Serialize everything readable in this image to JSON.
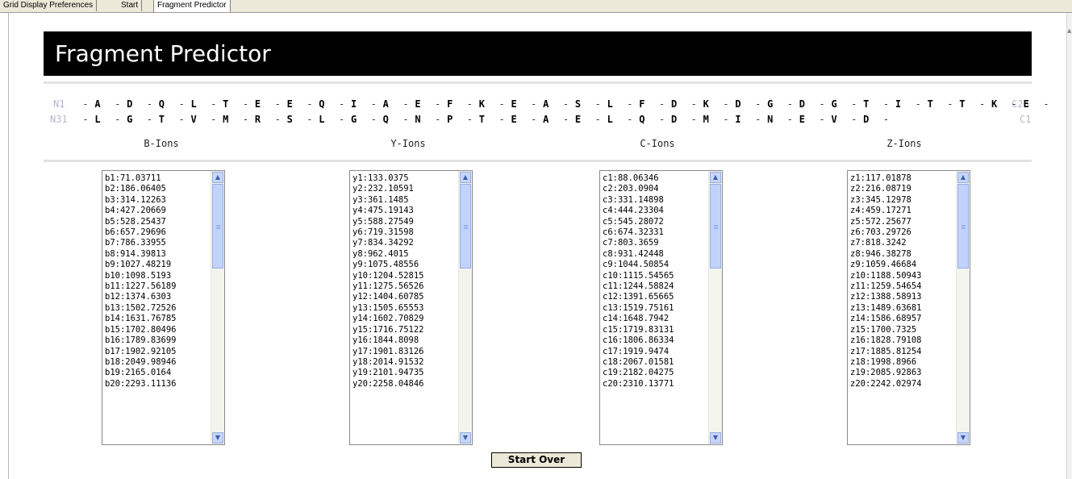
{
  "tabs": [
    {
      "label": "Grid Display Preferences"
    },
    {
      "label": "Start"
    },
    {
      "label": "Fragment Predictor",
      "active": true
    }
  ],
  "banner": {
    "title": "Fragment Predictor"
  },
  "sequence": {
    "row1": {
      "n_term": "N1",
      "c_term": "C26",
      "residues": [
        "A",
        "D",
        "Q",
        "L",
        "T",
        "E",
        "E",
        "Q",
        "I",
        "A",
        "E",
        "F",
        "K",
        "E",
        "A",
        "S",
        "L",
        "F",
        "D",
        "K",
        "D",
        "G",
        "D",
        "G",
        "T",
        "I",
        "T",
        "T",
        "K",
        "E"
      ]
    },
    "row2": {
      "n_term": "N31",
      "c_term": "C1",
      "residues": [
        "L",
        "G",
        "T",
        "V",
        "M",
        "R",
        "S",
        "L",
        "G",
        "Q",
        "N",
        "P",
        "T",
        "E",
        "A",
        "E",
        "L",
        "Q",
        "D",
        "M",
        "I",
        "N",
        "E",
        "V",
        "D"
      ]
    }
  },
  "ion_columns": [
    {
      "header": "B-Ions",
      "items": [
        "b1:71.03711",
        "b2:186.06405",
        "b3:314.12263",
        "b4:427.20669",
        "b5:528.25437",
        "b6:657.29696",
        "b7:786.33955",
        "b8:914.39813",
        "b9:1027.48219",
        "b10:1098.5193",
        "b11:1227.56189",
        "b12:1374.6303",
        "b13:1502.72526",
        "b14:1631.76785",
        "b15:1702.80496",
        "b16:1789.83699",
        "b17:1902.92105",
        "b18:2049.98946",
        "b19:2165.0164",
        "b20:2293.11136"
      ]
    },
    {
      "header": "Y-Ions",
      "items": [
        "y1:133.0375",
        "y2:232.10591",
        "y3:361.1485",
        "y4:475.19143",
        "y5:588.27549",
        "y6:719.31598",
        "y7:834.34292",
        "y8:962.4015",
        "y9:1075.48556",
        "y10:1204.52815",
        "y11:1275.56526",
        "y12:1404.60785",
        "y13:1505.65553",
        "y14:1602.70829",
        "y15:1716.75122",
        "y16:1844.8098",
        "y17:1901.83126",
        "y18:2014.91532",
        "y19:2101.94735",
        "y20:2258.04846"
      ]
    },
    {
      "header": "C-Ions",
      "items": [
        "c1:88.06346",
        "c2:203.0904",
        "c3:331.14898",
        "c4:444.23304",
        "c5:545.28072",
        "c6:674.32331",
        "c7:803.3659",
        "c8:931.42448",
        "c9:1044.50854",
        "c10:1115.54565",
        "c11:1244.58824",
        "c12:1391.65665",
        "c13:1519.75161",
        "c14:1648.7942",
        "c15:1719.83131",
        "c16:1806.86334",
        "c17:1919.9474",
        "c18:2067.01581",
        "c19:2182.04275",
        "c20:2310.13771"
      ]
    },
    {
      "header": "Z-Ions",
      "items": [
        "z1:117.01878",
        "z2:216.08719",
        "z3:345.12978",
        "z4:459.17271",
        "z5:572.25677",
        "z6:703.29726",
        "z7:818.3242",
        "z8:946.38278",
        "z9:1059.46684",
        "z10:1188.50943",
        "z11:1259.54654",
        "z12:1388.58913",
        "z13:1489.63681",
        "z14:1586.68957",
        "z15:1700.7325",
        "z16:1828.79108",
        "z17:1885.81254",
        "z18:1998.8966",
        "z19:2085.92863",
        "z20:2242.02974"
      ]
    }
  ],
  "actions": {
    "start_over": "Start Over"
  },
  "colors": {
    "banner_bg": "#000000",
    "terminus_label": "#b6b6d2",
    "scrollbar": "#c1d3fb"
  }
}
